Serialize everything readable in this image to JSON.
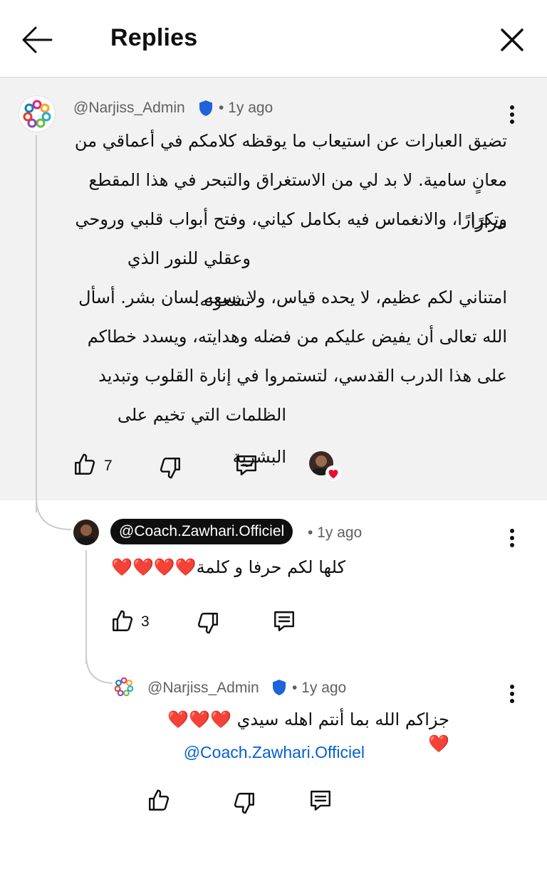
{
  "header": {
    "title": "Replies",
    "back_icon": "arrow-left-icon",
    "close_icon": "close-icon"
  },
  "colors": {
    "comment_highlight_bg": "#f2f2f2",
    "link": "#065fd4",
    "verified_badge": "#1e63d8",
    "heart": "#e8112d"
  },
  "comments": [
    {
      "author": "@Narjiss_Admin",
      "verified": true,
      "time": "• 1y ago",
      "paragraphs": [
        "تضيق العبارات عن استيعاب ما يوقظه كلامكم في أعماقي من",
        "معانٍ سامية. لا بد لي من الاستغراق والتبحر في هذا المقطع مرارًا",
        "وتكرارًا، والانغماس فيه بكامل كياني، وفتح أبواب قلبي وروحي",
        "وعقلي للنور الذي تشعونه.",
        "امتناني لكم عظيم، لا يحده قياس، ولا يسعه لسان بشر. أسأل",
        "الله تعالى أن يفيض عليكم من فضله وهدايته، ويسدد خطاكم",
        "على هذا الدرب القدسي، لتستمروا في إنارة القلوب وتبديد",
        "الظلمات التي تخيم على البشرية"
      ],
      "likes": "7",
      "creator_heart": true
    },
    {
      "author": "@Coach.Zawhari.Officiel",
      "time": "• 1y ago",
      "text": "كلها لكم حرفا و كلمة❤️❤️❤️❤️",
      "likes": "3"
    },
    {
      "author": "@Narjiss_Admin",
      "verified": true,
      "time": "• 1y ago",
      "text": "جزاكم الله بما أنتم اهله سيدي ❤️❤️❤️❤️",
      "mention": "Coach.Zawhari.Officiel@",
      "likes": ""
    }
  ],
  "icons": {
    "like": "thumbs-up-icon",
    "dislike": "thumbs-down-icon",
    "reply": "reply-comment-icon",
    "more": "more-vertical-icon",
    "verified": "verified-badge-icon"
  }
}
